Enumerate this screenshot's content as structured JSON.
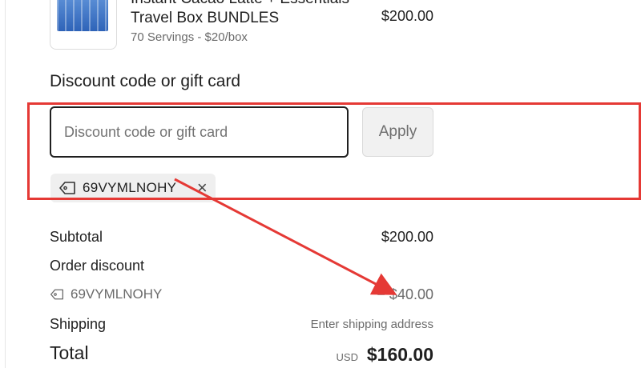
{
  "product": {
    "name_line1": "Instant Cacao Latte + Essentials",
    "name_line2": "Travel Box BUNDLES",
    "subtitle": "70 Servings - $20/box",
    "price": "$200.00",
    "thumbnail_icon": "product-boxes-image"
  },
  "discount": {
    "section_title": "Discount code or gift card",
    "input_placeholder": "Discount code or gift card",
    "input_value": "",
    "apply_label": "Apply",
    "applied_code": "69VYMLNOHY",
    "remove_icon": "×"
  },
  "summary": {
    "subtotal_label": "Subtotal",
    "subtotal_value": "$200.00",
    "order_discount_label": "Order discount",
    "discount_code": "69VYMLNOHY",
    "discount_value": "− $40.00",
    "shipping_label": "Shipping",
    "shipping_value": "Enter shipping address",
    "total_label": "Total",
    "currency": "USD",
    "total_value": "$160.00"
  },
  "colors": {
    "highlight": "#e53935",
    "apply_bg": "#f1f1f1"
  }
}
